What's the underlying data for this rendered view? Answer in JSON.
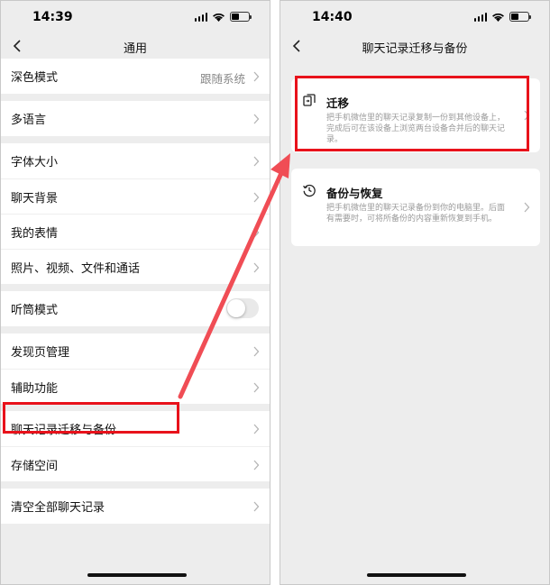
{
  "left_phone": {
    "status_time": "14:39",
    "title": "通用",
    "rows": [
      {
        "label": "深色模式",
        "value": "跟随系统"
      },
      {
        "label": "多语言"
      },
      {
        "label": "字体大小"
      },
      {
        "label": "聊天背景"
      },
      {
        "label": "我的表情"
      },
      {
        "label": "照片、视频、文件和通话"
      },
      {
        "label": "听筒模式",
        "toggle": false
      },
      {
        "label": "发现页管理"
      },
      {
        "label": "辅助功能"
      },
      {
        "label": "聊天记录迁移与备份"
      },
      {
        "label": "存储空间"
      },
      {
        "label": "清空全部聊天记录"
      }
    ]
  },
  "right_phone": {
    "status_time": "14:40",
    "title": "聊天记录迁移与备份",
    "cards": [
      {
        "title": "迁移",
        "description": "把手机微信里的聊天记录复制一份到其他设备上，完成后可在该设备上浏览两台设备合并后的聊天记录。",
        "icon": "transfer-icon"
      },
      {
        "title": "备份与恢复",
        "description": "把手机微信里的聊天记录备份到你的电脑里。后面有需要时，可将所备份的内容重新恢复到手机。",
        "icon": "history-icon"
      }
    ]
  },
  "colors": {
    "highlight": "#e8121b",
    "arrow": "#f04d55",
    "background": "#ededed"
  }
}
